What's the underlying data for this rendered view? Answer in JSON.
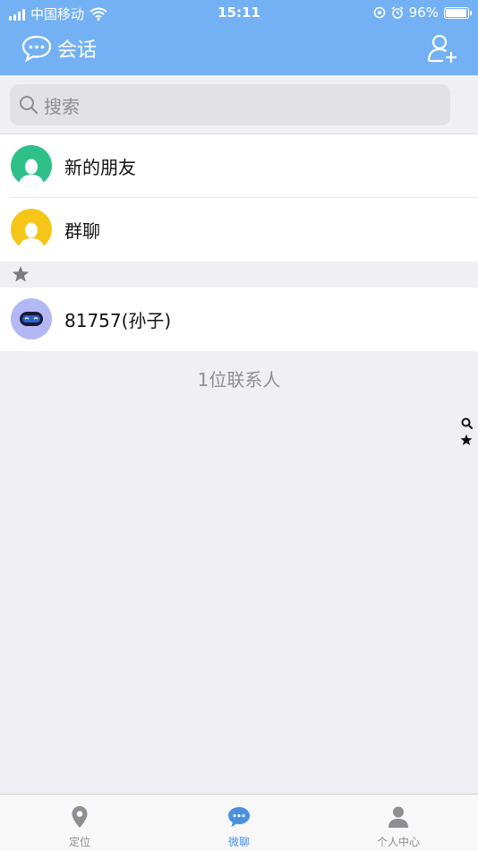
{
  "status_bar": {
    "carrier": "中国移动",
    "time": "15:11",
    "battery_percent": "96%",
    "battery_level": 0.96
  },
  "navbar": {
    "title": "会话",
    "left_icon": "chat-bubbles-icon",
    "right_icon": "add-friend-icon"
  },
  "search": {
    "placeholder": "搜索"
  },
  "function_items": [
    {
      "label": "新的朋友",
      "icon": "person-icon",
      "color": "#2fbf8a"
    },
    {
      "label": "群聊",
      "icon": "person-icon",
      "color": "#f5c518"
    }
  ],
  "section": {
    "header_icon": "star-icon"
  },
  "contacts": [
    {
      "name": "81757(孙子)",
      "icon": "robot-icon",
      "color": "#b3b8f5"
    }
  ],
  "contact_count_text": "1位联系人",
  "index_bar": [
    "search-icon",
    "star-icon"
  ],
  "tabbar": {
    "tabs": [
      {
        "label": "定位",
        "icon": "location-pin-icon",
        "active": false
      },
      {
        "label": "微聊",
        "icon": "chat-icon",
        "active": true
      },
      {
        "label": "个人中心",
        "icon": "user-icon",
        "active": false
      }
    ]
  },
  "colors": {
    "header_bg": "#73b1f4",
    "active_tab": "#4a90e2",
    "page_bg": "#efeff4"
  }
}
